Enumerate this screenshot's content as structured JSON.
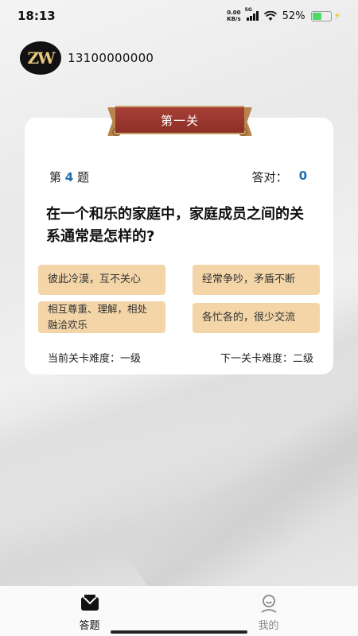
{
  "status_bar": {
    "time": "18:13",
    "net_speed_value": "0.00",
    "net_speed_unit": "KB/s",
    "network_type": "5G",
    "battery_percent": "52%",
    "battery_level": 0.52
  },
  "header": {
    "logo_text": "ZW",
    "phone": "13100000000"
  },
  "level_banner": "第一关",
  "question_label_prefix": "第",
  "question_number": "4",
  "question_label_suffix": "题",
  "score_label": "答对：",
  "score_value": "0",
  "question_text": "在一个和乐的家庭中，家庭成员之间的关系通常是怎样的?",
  "options": [
    "彼此冷漠，互不关心",
    "经常争吵，矛盾不断",
    "相互尊重、理解，相处融洽欢乐",
    "各忙各的，很少交流"
  ],
  "current_level_difficulty": "当前关卡难度：一级",
  "next_level_difficulty": "下一关卡难度：二级",
  "tabs": [
    {
      "label": "答题",
      "icon": "quiz-icon",
      "active": true
    },
    {
      "label": "我的",
      "icon": "profile-icon",
      "active": false
    }
  ],
  "colors": {
    "accent_blue": "#1f6fb0",
    "banner_red": "#9a3830",
    "option_bg": "#f3d5a8"
  }
}
